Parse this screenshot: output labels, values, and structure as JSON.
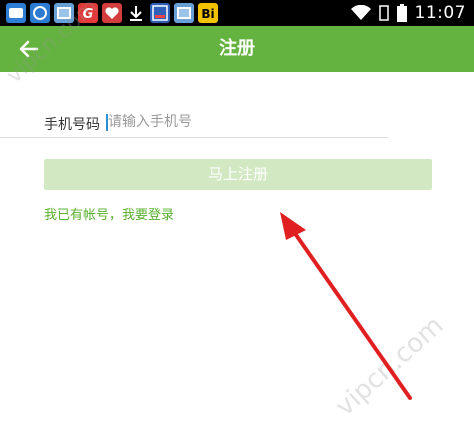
{
  "status_bar": {
    "app_icons": [
      {
        "name": "chat-app-icon",
        "color": "#2f7ed6"
      },
      {
        "name": "browser-app-icon",
        "color": "#2a7bd1"
      },
      {
        "name": "photo-app-icon",
        "color": "#6aa0d8"
      },
      {
        "name": "g-app-icon",
        "color": "#e23a3a",
        "text": "G"
      },
      {
        "name": "heart-app-icon",
        "color": "#d23e3e"
      },
      {
        "name": "download-icon",
        "color": "#000000"
      },
      {
        "name": "store-app-icon",
        "color": "#2c5fb8"
      },
      {
        "name": "photo2-app-icon",
        "color": "#6aa0d8"
      },
      {
        "name": "bi-app-icon",
        "color": "#f2c200",
        "text": "Bi"
      }
    ],
    "time": "11:07"
  },
  "appbar": {
    "title": "注册",
    "color": "#64b340"
  },
  "form": {
    "phone_label": "手机号码",
    "phone_placeholder": "请输入手机号",
    "register_label": "马上注册",
    "login_link": "我已有帐号，我要登录"
  },
  "watermarks": [
    "vipcn.com",
    "vipcn.com"
  ]
}
